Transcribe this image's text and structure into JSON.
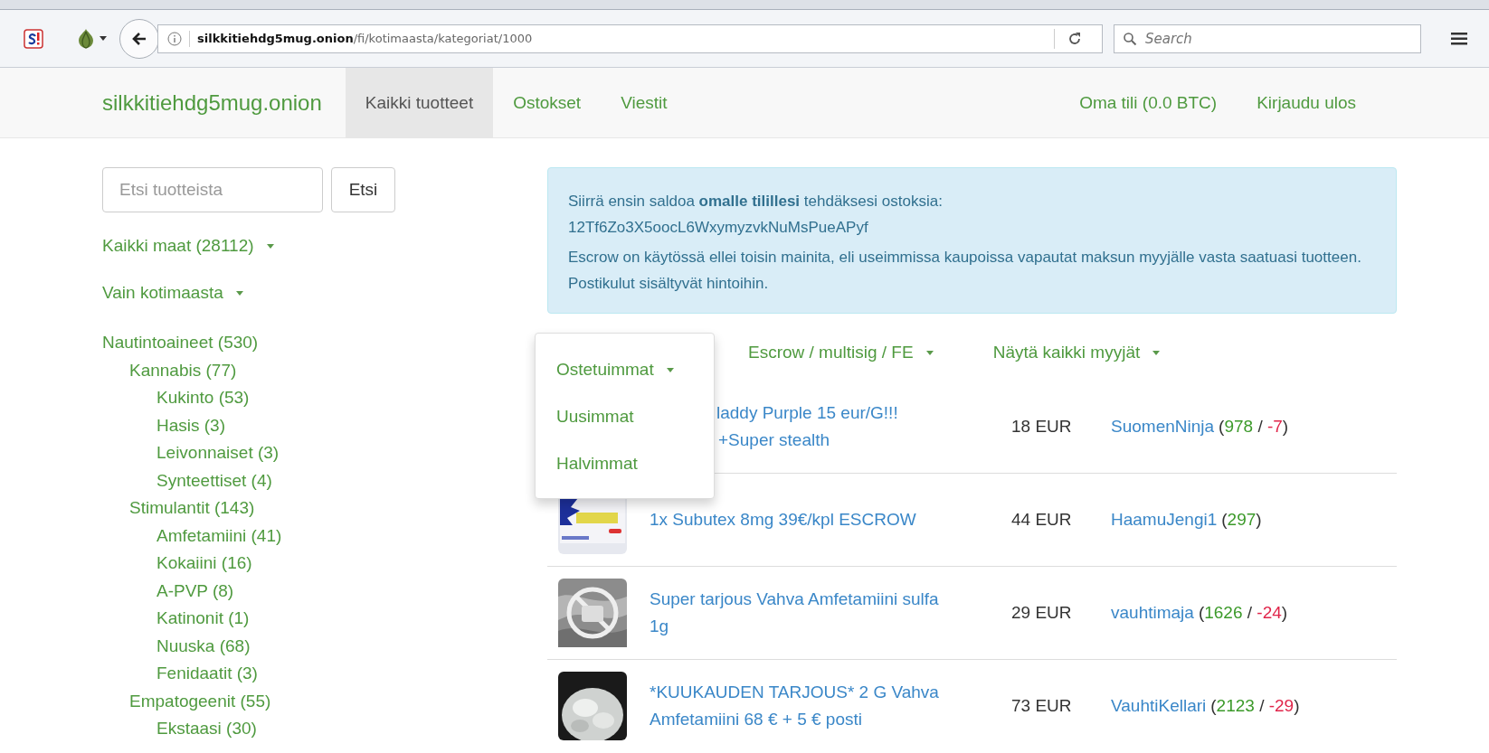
{
  "browser": {
    "url_domain": "silkkitiehdg5mug.onion",
    "url_path": "/fi/kotimaasta/kategoriat/1000",
    "search_placeholder": "Search"
  },
  "navbar": {
    "brand": "silkkitiehdg5mug.onion",
    "items": [
      {
        "label": "Kaikki tuotteet",
        "selected": true
      },
      {
        "label": "Ostokset",
        "selected": false
      },
      {
        "label": "Viestit",
        "selected": false
      }
    ],
    "right_items": [
      "Oma tili (0.0 BTC)",
      "Kirjaudu ulos"
    ]
  },
  "sidebar": {
    "search_placeholder": "Etsi tuotteista",
    "search_button": "Etsi",
    "filters": [
      "Kaikki maat (28112)",
      "Vain kotimaasta"
    ],
    "categories": [
      {
        "label": "Nautintoaineet (530)",
        "children": [
          {
            "label": "Kannabis (77)",
            "children": [
              {
                "label": "Kukinto (53)"
              },
              {
                "label": "Hasis (3)"
              },
              {
                "label": "Leivonnaiset (3)"
              },
              {
                "label": "Synteettiset (4)"
              }
            ]
          },
          {
            "label": "Stimulantit (143)",
            "children": [
              {
                "label": "Amfetamiini (41)"
              },
              {
                "label": "Kokaiini (16)"
              },
              {
                "label": "A-PVP (8)"
              },
              {
                "label": "Katinonit (1)"
              },
              {
                "label": "Nuuska (68)"
              },
              {
                "label": "Fenidaatit (3)"
              }
            ]
          },
          {
            "label": "Empatogeenit (55)",
            "children": [
              {
                "label": "Ekstaasi (30)"
              }
            ]
          }
        ]
      }
    ]
  },
  "alert": {
    "text": "Siirrä ensin saldoa **omalle tilillesi** tehdäksesi ostoksia:",
    "address": "12Tf6Zo3X5oocL6WxymyzvkNuMsPueAPyf",
    "note": "Escrow on käytössä ellei toisin mainita, eli useimmissa kaupoissa vapautat maksun myyjälle vasta saatuasi tuotteen. Postikulut sisältyvät hintoihin."
  },
  "filters": [
    "Escrow / multisig / FE",
    "Näytä kaikki myyjät"
  ],
  "sort_menu": {
    "label": "Ostetuimmat",
    "items": [
      "Uusimmat",
      "Halvimmat"
    ]
  },
  "listings": [
    {
      "title_lines": [
        "laddy Purple 15 eur/G!!!",
        "+Super stealth"
      ],
      "covered": true,
      "price": "18 EUR",
      "seller": "SuomenNinja",
      "rating": [
        {
          "text": "(",
          "kind": "plain"
        },
        {
          "text": "978",
          "kind": "positive"
        },
        {
          "text": " / ",
          "kind": "plain"
        },
        {
          "text": "-7",
          "kind": "negative"
        },
        {
          "text": ")",
          "kind": "plain"
        }
      ]
    },
    {
      "title_lines": [
        "1x Subutex 8mg 39€/kpl ESCROW"
      ],
      "covered": false,
      "price": "44 EUR",
      "seller": "HaamuJengi1",
      "rating": [
        {
          "text": "(",
          "kind": "plain"
        },
        {
          "text": "297",
          "kind": "positive"
        },
        {
          "text": ")",
          "kind": "plain"
        }
      ]
    },
    {
      "title_lines": [
        "Super tarjous Vahva Amfetamiini sulfa",
        "1g"
      ],
      "covered": false,
      "price": "29 EUR",
      "seller": "vauhtimaja",
      "rating": [
        {
          "text": "(",
          "kind": "plain"
        },
        {
          "text": "1626",
          "kind": "positive"
        },
        {
          "text": " / ",
          "kind": "plain"
        },
        {
          "text": "-24",
          "kind": "negative"
        },
        {
          "text": ")",
          "kind": "plain"
        }
      ]
    },
    {
      "title_lines": [
        "*KUUKAUDEN TARJOUS* 2 G Vahva",
        "Amfetamiini 68 € + 5 € posti"
      ],
      "covered": false,
      "price": "73 EUR",
      "seller": "VauhtiKellari",
      "rating": [
        {
          "text": "(",
          "kind": "plain"
        },
        {
          "text": "2123",
          "kind": "positive"
        },
        {
          "text": " / ",
          "kind": "plain"
        },
        {
          "text": "-29",
          "kind": "negative"
        },
        {
          "text": ")",
          "kind": "plain"
        }
      ]
    }
  ]
}
